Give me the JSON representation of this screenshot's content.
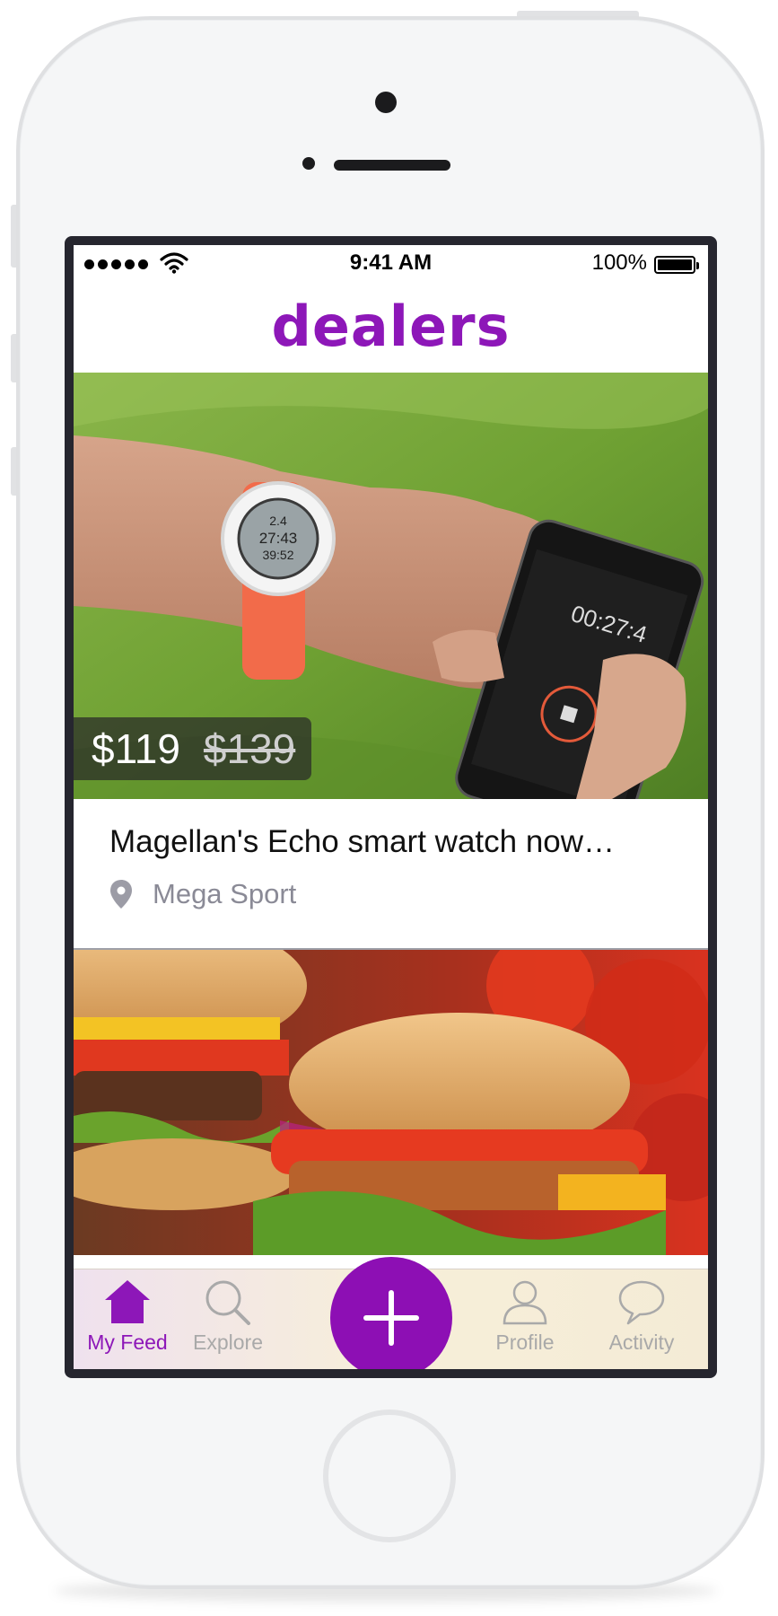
{
  "status_bar": {
    "time": "9:41 AM",
    "battery": "100%",
    "signal_icon": "signal-dots-icon",
    "wifi_icon": "wifi-icon",
    "battery_icon": "battery-icon"
  },
  "header": {
    "logo": "dealers"
  },
  "colors": {
    "brand": "#8d17b8",
    "inactive_tab": "#a9a9a9"
  },
  "feed": {
    "cards": [
      {
        "price": "$119",
        "old_price": "$139",
        "title": "Magellan's Echo smart watch now…",
        "location": "Mega Sport",
        "location_icon": "location-pin-icon",
        "image": "smart watch on wrist with phone app"
      },
      {
        "image": "burgers"
      }
    ]
  },
  "tab_bar": {
    "tabs": [
      {
        "label": "My Feed",
        "icon": "home-icon",
        "active": true
      },
      {
        "label": "Explore",
        "icon": "search-icon",
        "active": false
      },
      {
        "label": "Profile",
        "icon": "person-icon",
        "active": false
      },
      {
        "label": "Activity",
        "icon": "speech-bubble-icon",
        "active": false
      }
    ],
    "add_icon": "plus-icon"
  }
}
